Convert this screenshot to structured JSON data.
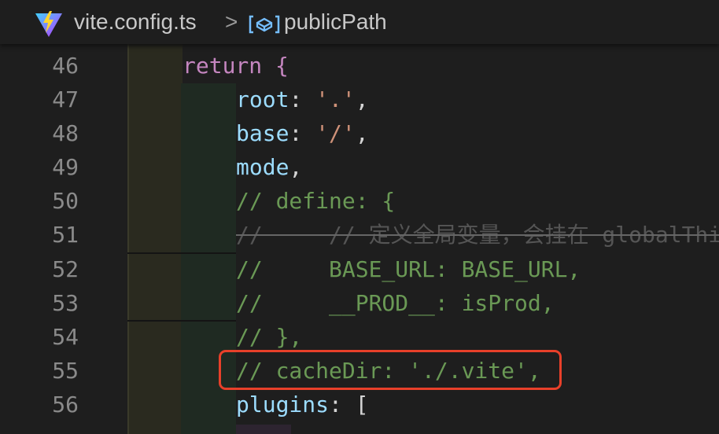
{
  "breadcrumb": {
    "file": "vite.config.ts",
    "separator": ">",
    "symbol": "publicPath",
    "file_icon": "vite-logo-icon",
    "symbol_icon": "variable-icon"
  },
  "lines": [
    {
      "n": "46",
      "code": "return {"
    },
    {
      "n": "47",
      "key": "root",
      "val": "'.'"
    },
    {
      "n": "48",
      "key": "base",
      "val": "'/'"
    },
    {
      "n": "49",
      "key": "mode"
    },
    {
      "n": "50",
      "comment": "// define: {"
    },
    {
      "n": "51",
      "comment": "//     // 定义全局变量，会挂在 globalThis"
    },
    {
      "n": "52",
      "comment": "//     BASE_URL: BASE_URL,"
    },
    {
      "n": "53",
      "comment": "//     __PROD__: isProd,"
    },
    {
      "n": "54",
      "comment": "// },"
    },
    {
      "n": "55",
      "comment": "// cacheDir: './.vite',"
    },
    {
      "n": "56",
      "key": "plugins",
      "code": "["
    }
  ],
  "highlight_color": "#e8402a"
}
